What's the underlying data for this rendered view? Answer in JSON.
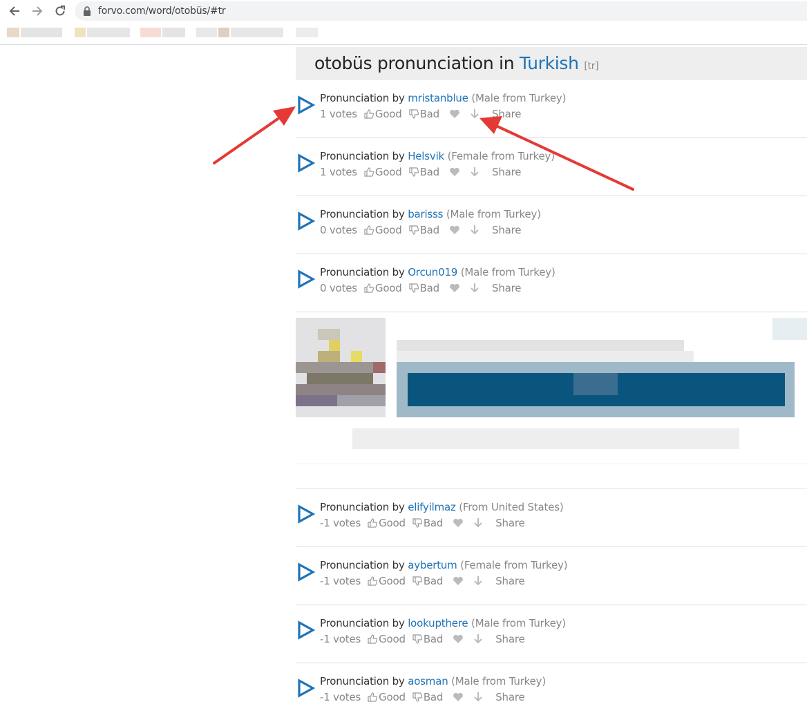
{
  "browser": {
    "url": "forvo.com/word/otobüs/#tr"
  },
  "header": {
    "title_prefix": "otobüs pronunciation in",
    "language": "Turkish",
    "code": "[tr]"
  },
  "labels": {
    "pronunciation_by": "Pronunciation by",
    "good": "Good",
    "bad": "Bad",
    "share": "Share"
  },
  "pronunciations": [
    {
      "user": "mristanblue",
      "meta": "(Male from Turkey)",
      "votes": "1 votes"
    },
    {
      "user": "Helsvik",
      "meta": "(Female from Turkey)",
      "votes": "1 votes"
    },
    {
      "user": "barisss",
      "meta": "(Male from Turkey)",
      "votes": "0 votes"
    },
    {
      "user": "Orcun019",
      "meta": "(Male from Turkey)",
      "votes": "0 votes"
    },
    {
      "user": "elifyilmaz",
      "meta": "(From United States)",
      "votes": "-1 votes"
    },
    {
      "user": "aybertum",
      "meta": "(Female from Turkey)",
      "votes": "-1 votes"
    },
    {
      "user": "lookupthere",
      "meta": "(Male from Turkey)",
      "votes": "-1 votes"
    },
    {
      "user": "aosman",
      "meta": "(Male from Turkey)",
      "votes": "-1 votes"
    }
  ],
  "colors": {
    "accent_blue": "#1f73b7",
    "annotation_red": "#e53935",
    "ad_banner": "#0a557e"
  }
}
